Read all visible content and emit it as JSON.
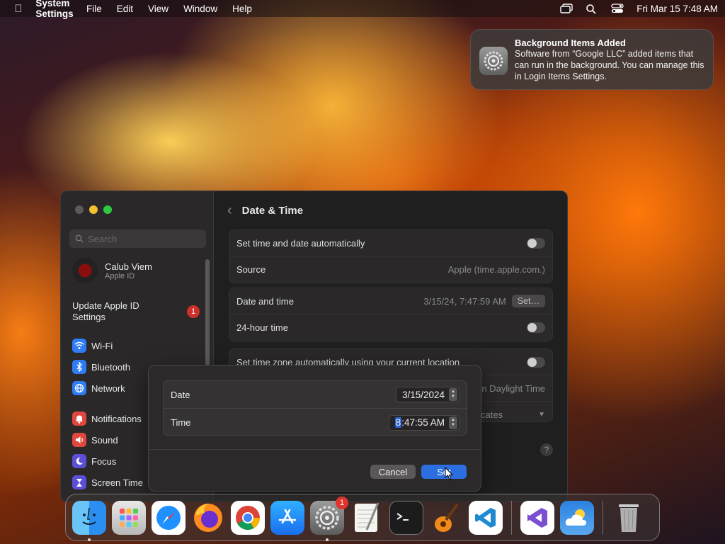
{
  "menubar": {
    "app_name": "System Settings",
    "menus": [
      "File",
      "Edit",
      "View",
      "Window",
      "Help"
    ],
    "clock": "Fri Mar 15  7:48 AM"
  },
  "notification": {
    "title": "Background Items Added",
    "body": "Software from “Google LLC” added items that can run in the background. You can manage this in Login Items Settings."
  },
  "sidebar": {
    "search_placeholder": "Search",
    "account_name": "Calub Viem",
    "account_sub": "Apple ID",
    "update_label": "Update Apple ID Settings",
    "update_badge": "1",
    "items": [
      {
        "label": "Wi-Fi",
        "color": "#2f7cf6"
      },
      {
        "label": "Bluetooth",
        "color": "#2f7cf6"
      },
      {
        "label": "Network",
        "color": "#2f7cf6"
      },
      {
        "label": "Notifications",
        "color": "#e0483e"
      },
      {
        "label": "Sound",
        "color": "#e0483e"
      },
      {
        "label": "Focus",
        "color": "#5b4fd6"
      },
      {
        "label": "Screen Time",
        "color": "#5b4fd6"
      }
    ]
  },
  "main": {
    "title": "Date & Time",
    "set_auto_label": "Set time and date automatically",
    "source_label": "Source",
    "source_value": "Apple (time.apple.com.)",
    "date_time_label": "Date and time",
    "date_time_value": "3/15/24, 7:47:59 AM",
    "set_button": "Set…",
    "hour24_label": "24-hour time",
    "tz_auto_label": "Set time zone automatically using your current location",
    "partial_daylight": "n Daylight Time",
    "partial_cates": "cates"
  },
  "dialog": {
    "date_label": "Date",
    "date_value": "3/15/2024",
    "time_label": "Time",
    "time_hour": "8",
    "time_rest": ":47:55 AM",
    "cancel_label": "Cancel",
    "set_label": "Set"
  },
  "dock": {
    "settings_badge": "1",
    "apps": [
      "Finder",
      "Launchpad",
      "Safari",
      "Firefox",
      "Chrome",
      "App Store",
      "System Settings",
      "TextEdit",
      "Terminal",
      "GarageBand",
      "Visual Studio Code",
      "Visual Studio",
      "Weather",
      "Trash"
    ]
  }
}
